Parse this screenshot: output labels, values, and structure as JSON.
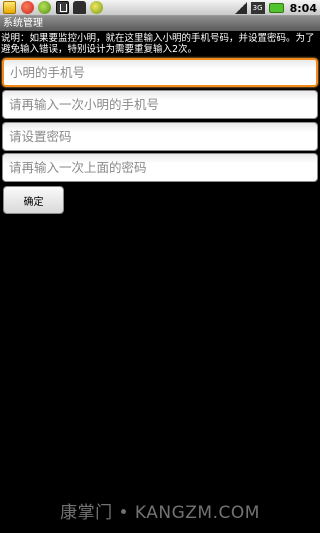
{
  "status_bar": {
    "notification_icons": [
      "battery-low-icon",
      "alert-icon",
      "app-icon",
      "usb-icon",
      "android-icon",
      "app-icon"
    ],
    "signal_label": "3G",
    "time": "8:04"
  },
  "app": {
    "title": "系统管理"
  },
  "description": "说明：如果要监控小明，就在这里输入小明的手机号码，并设置密码。为了避免输入错误，特别设计为需要重复输入2次。",
  "form": {
    "phone_placeholder": "小明的手机号",
    "phone_confirm_placeholder": "请再输入一次小明的手机号",
    "password_placeholder": "请设置密码",
    "password_confirm_placeholder": "请再输入一次上面的密码",
    "confirm_label": "确定"
  },
  "watermark": "康掌门 • KANGZM.COM",
  "colors": {
    "focus_border": "#f58a1c",
    "background": "#000000"
  }
}
